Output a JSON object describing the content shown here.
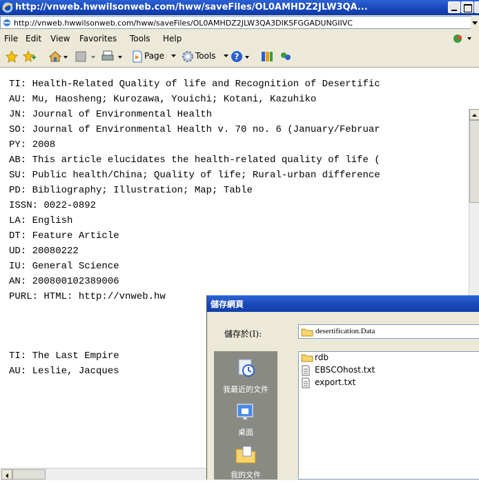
{
  "window": {
    "title": "http://vnweb.hwwilsonweb.com/hww/saveFiles/OL0AMHDZ2JLW3QA...",
    "address": "http://vnweb.hwwilsonweb.com/hww/saveFiles/OL0AMHDZ2JLW3QA3DIKSFGGADUNGIIVC"
  },
  "menu": [
    "File",
    "Edit",
    "View",
    "Favorites",
    "Tools",
    "Help"
  ],
  "toolbar": {
    "page_label": "Page",
    "tools_label": "Tools"
  },
  "record": [
    "TI: Health-Related Quality of life and Recognition of Desertific",
    "AU: Mu, Haosheng; Kurozawa, Youichi; Kotani, Kazuhiko",
    "JN: Journal of Environmental Health",
    "SO: Journal of Environmental Health v. 70 no. 6 (January/Februar",
    "PY: 2008",
    "AB: This article elucidates the health-related quality of life (",
    "SU: Public health/China; Quality of life; Rural-urban difference",
    "PD: Bibliography; Illustration; Map; Table",
    "ISSN: 0022-0892",
    "LA: English",
    "DT: Feature Article",
    "UD: 20080222",
    "IU: General Science",
    "AN: 200800102389006",
    "PURL: HTML: http://vnweb.hw",
    "",
    "",
    "TI: The Last Empire",
    "AU: Leslie, Jacques"
  ],
  "dialog": {
    "title": "儲存網頁",
    "save_in_label": "儲存於(I):",
    "folder": "desertification.Data",
    "places": [
      "我最近的文件",
      "桌面",
      "我的文件"
    ],
    "files": [
      "rdb",
      "EBSCOhost.txt",
      "export.txt"
    ]
  }
}
